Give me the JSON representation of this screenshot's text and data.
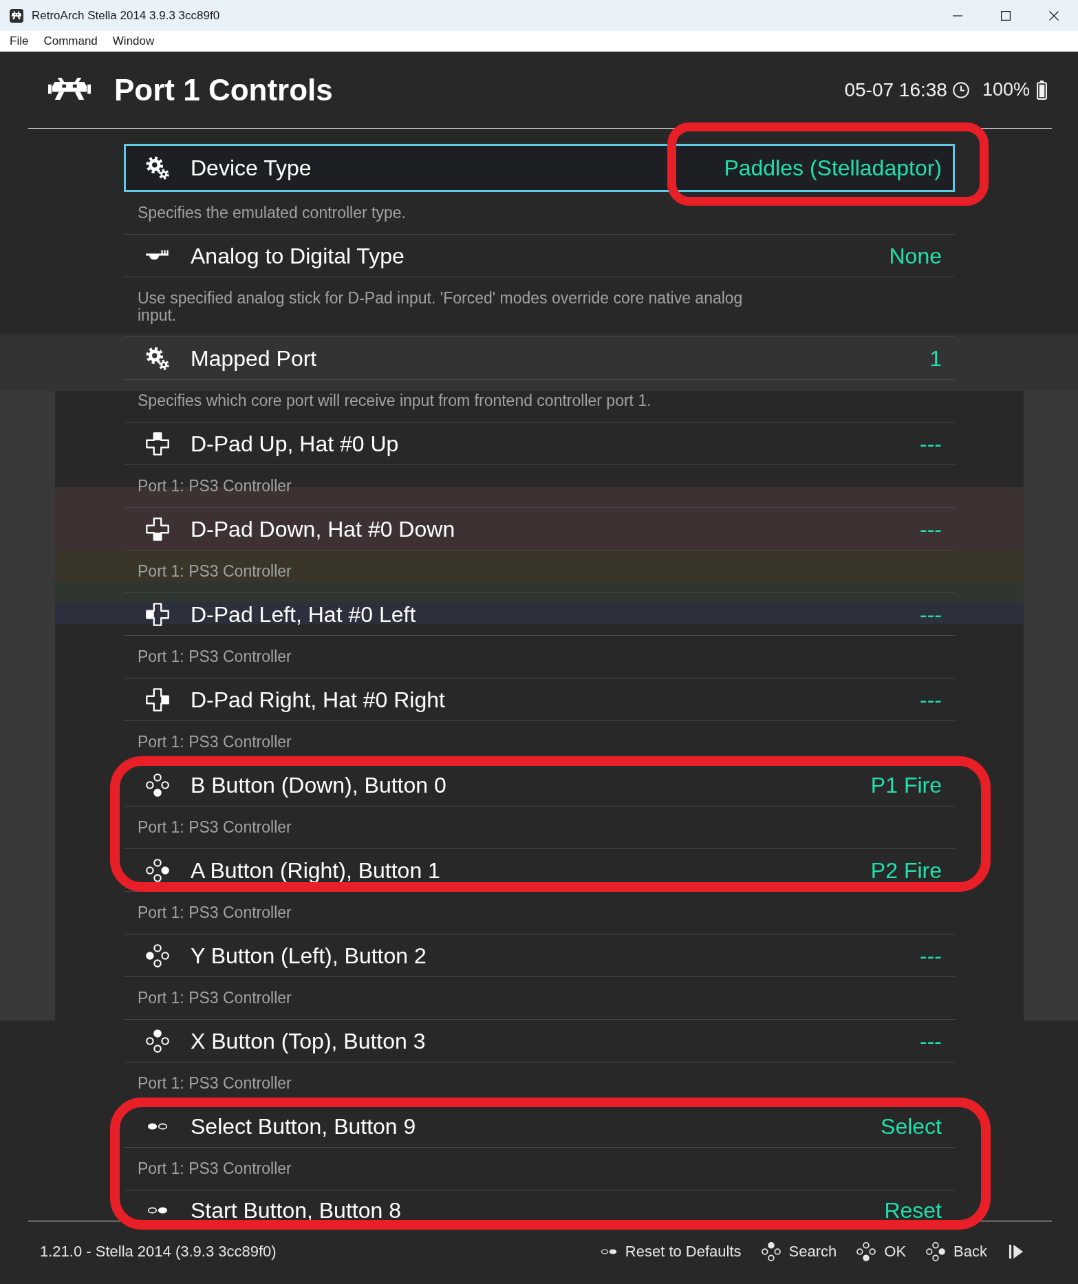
{
  "window": {
    "title": "RetroArch Stella 2014 3.9.3 3cc89f0",
    "menu": [
      "File",
      "Command",
      "Window"
    ]
  },
  "header": {
    "title": "Port 1 Controls",
    "clock": "05-07 16:38",
    "battery": "100%"
  },
  "settings": [
    {
      "kind": "gears",
      "label": "Device Type",
      "value": "Paddles (Stelladaptor)",
      "description": "Specifies the emulated controller type.",
      "selected": true,
      "value_circled": true,
      "row_circled": false
    },
    {
      "kind": "analog",
      "label": "Analog to Digital Type",
      "value": "None",
      "description": "Use specified analog stick for D-Pad input. 'Forced' modes override core native analog input.",
      "selected": false,
      "value_circled": false,
      "row_circled": false
    },
    {
      "kind": "gears",
      "label": "Mapped Port",
      "value": "1",
      "description": "Specifies which core port will receive input from frontend controller port 1.",
      "selected": false,
      "value_circled": false,
      "row_circled": false
    },
    {
      "kind": "dpad-up",
      "label": "D-Pad Up, Hat #0 Up",
      "value": "---",
      "description": "Port 1: PS3 Controller",
      "selected": false,
      "value_circled": false,
      "row_circled": false
    },
    {
      "kind": "dpad-down",
      "label": "D-Pad Down, Hat #0 Down",
      "value": "---",
      "description": "Port 1: PS3 Controller",
      "selected": false,
      "value_circled": false,
      "row_circled": false
    },
    {
      "kind": "dpad-left",
      "label": "D-Pad Left, Hat #0 Left",
      "value": "---",
      "description": "Port 1: PS3 Controller",
      "selected": false,
      "value_circled": false,
      "row_circled": false
    },
    {
      "kind": "dpad-right",
      "label": "D-Pad Right, Hat #0 Right",
      "value": "---",
      "description": "Port 1: PS3 Controller",
      "selected": false,
      "value_circled": false,
      "row_circled": false
    },
    {
      "kind": "face-bottom",
      "label": "B Button (Down), Button 0",
      "value": "P1 Fire",
      "description": "Port 1: PS3 Controller",
      "selected": false,
      "value_circled": false,
      "row_circled": true
    },
    {
      "kind": "face-right",
      "label": "A Button (Right), Button 1",
      "value": "P2 Fire",
      "description": "Port 1: PS3 Controller",
      "selected": false,
      "value_circled": false,
      "row_circled": true
    },
    {
      "kind": "face-left",
      "label": "Y Button (Left), Button 2",
      "value": "---",
      "description": "Port 1: PS3 Controller",
      "selected": false,
      "value_circled": false,
      "row_circled": false
    },
    {
      "kind": "face-top",
      "label": "X Button (Top), Button 3",
      "value": "---",
      "description": "Port 1: PS3 Controller",
      "selected": false,
      "value_circled": false,
      "row_circled": false
    },
    {
      "kind": "pill-left",
      "label": "Select Button, Button 9",
      "value": "Select",
      "description": "Port 1: PS3 Controller",
      "selected": false,
      "value_circled": false,
      "row_circled": true
    },
    {
      "kind": "pill-right",
      "label": "Start Button, Button 8",
      "value": "Reset",
      "selected": false,
      "value_circled": false,
      "row_circled": true
    }
  ],
  "footer": {
    "version": "1.21.0 - Stella 2014 (3.9.3 3cc89f0)",
    "actions": [
      {
        "kind": "pill-right",
        "label": "Reset to Defaults"
      },
      {
        "kind": "face-top",
        "label": "Search"
      },
      {
        "kind": "face-bottom",
        "label": "OK"
      },
      {
        "kind": "face-right",
        "label": "Back"
      }
    ]
  }
}
